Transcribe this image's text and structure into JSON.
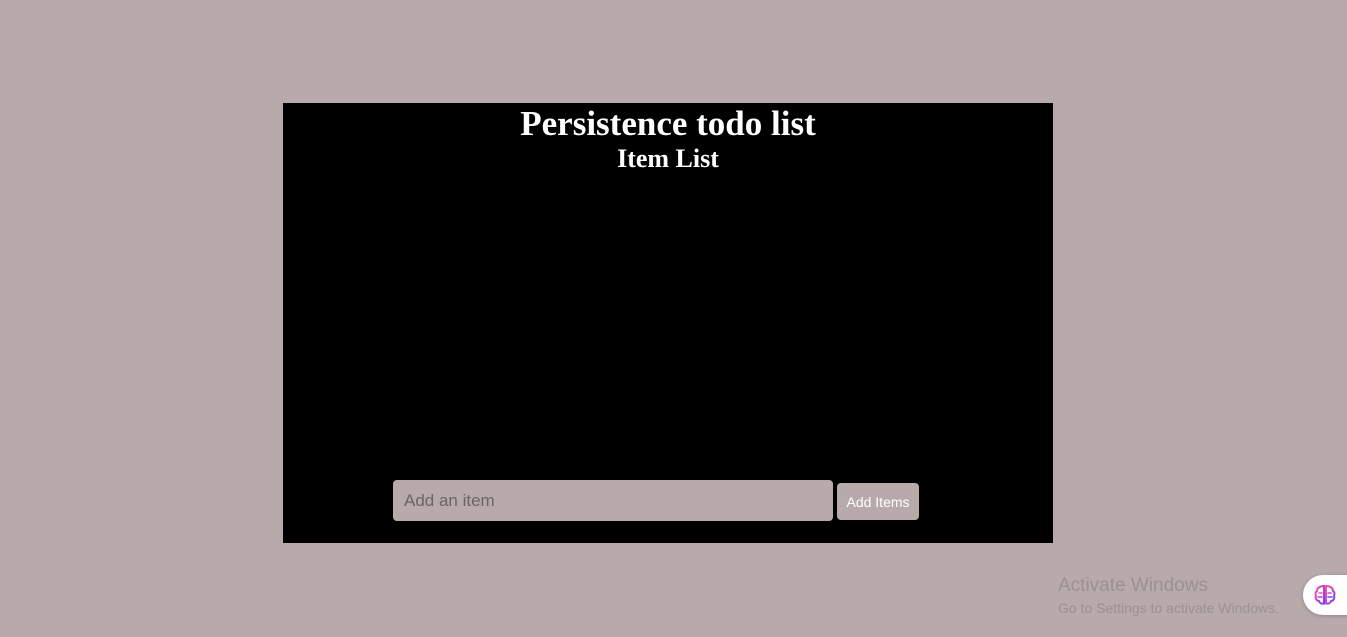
{
  "header": {
    "title": "Persistence todo list",
    "subtitle": "Item List"
  },
  "items": [],
  "form": {
    "input_placeholder": "Add an item",
    "input_value": "",
    "add_button_label": "Add Items"
  },
  "overlay": {
    "activation_title": "Activate Windows",
    "activation_subtitle": "Go to Settings to activate Windows.",
    "assistant_icon": "brain-icon"
  },
  "colors": {
    "page_background": "#b8a9ab",
    "panel_background": "#000000",
    "heading_text": "#ffffff",
    "control_background": "#b8a9ab"
  }
}
